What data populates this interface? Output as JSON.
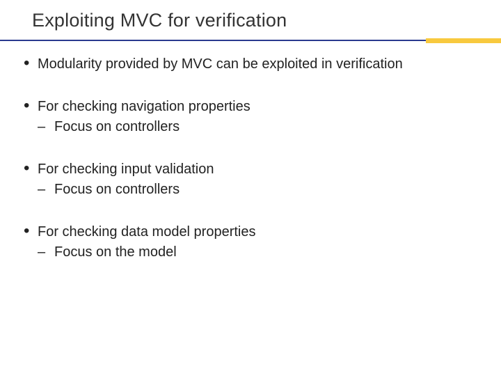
{
  "title": "Exploiting MVC for verification",
  "bullets": [
    {
      "text": "Modularity provided by MVC can be exploited in verification",
      "subs": []
    },
    {
      "text": "For checking navigation properties",
      "subs": [
        "Focus on controllers"
      ]
    },
    {
      "text": "For checking input validation",
      "subs": [
        "Focus on controllers"
      ]
    },
    {
      "text": "For checking data model properties",
      "subs": [
        "Focus on the model"
      ]
    }
  ]
}
